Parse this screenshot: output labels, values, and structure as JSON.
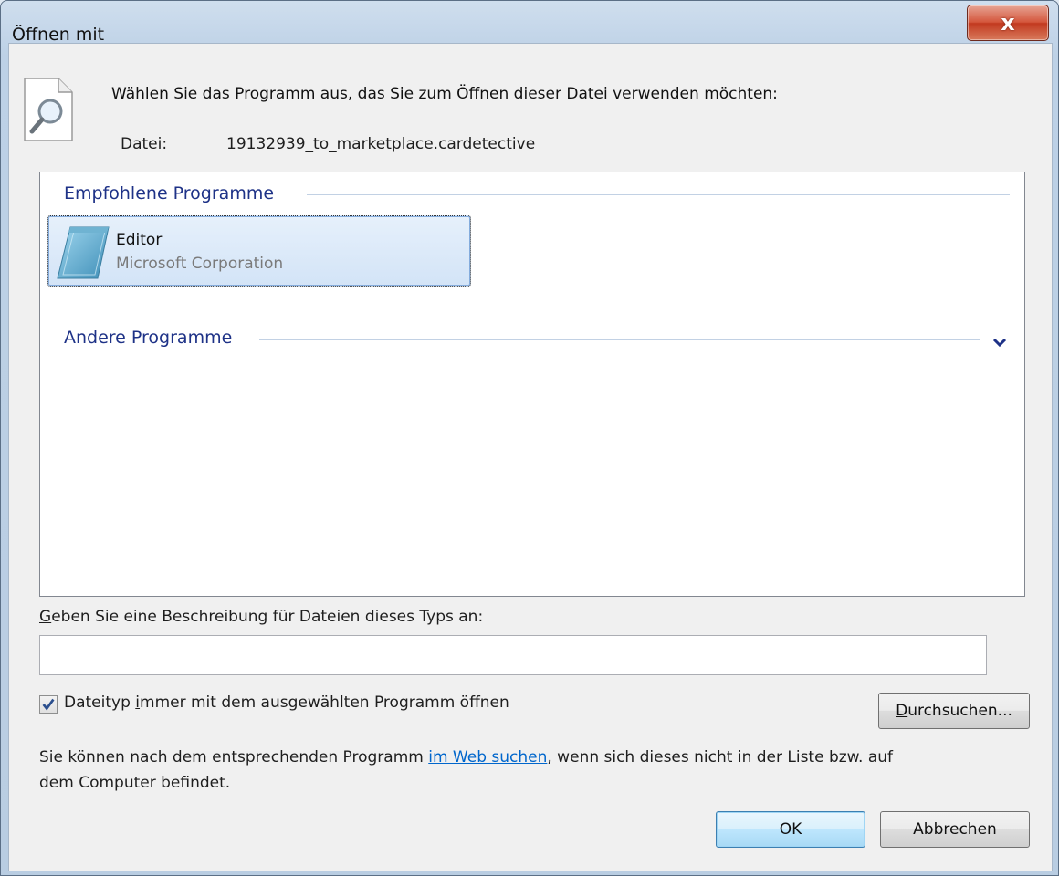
{
  "window": {
    "title": "Öffnen mit",
    "close_glyph": "x"
  },
  "header": {
    "prompt": "Wählen Sie das Programm aus, das Sie zum Öffnen dieser Datei verwenden möchten:",
    "file_label": "Datei:",
    "file_name": "19132939_to_marketplace.cardetective"
  },
  "list": {
    "recommended_header": "Empfohlene Programme",
    "other_header": "Andere Programme",
    "recommended_programs": [
      {
        "name": "Editor",
        "company": "Microsoft Corporation",
        "icon": "notepad-icon"
      }
    ]
  },
  "description": {
    "label_mnemonic": "G",
    "label_rest": "eben Sie eine Beschreibung für Dateien dieses Typs an:",
    "value": "",
    "placeholder": ""
  },
  "always_open": {
    "label_before": "Dateityp ",
    "label_mnemonic": "i",
    "label_after": "mmer mit dem ausgewählten Programm öffnen",
    "checked": true
  },
  "browse_button": {
    "mnemonic": "D",
    "rest": "urchsuchen..."
  },
  "info": {
    "text_before": "Sie können nach dem entsprechenden Programm ",
    "link_text": "im Web suchen",
    "text_after": ", wenn sich dieses nicht in der Liste bzw. auf",
    "line2": "dem Computer befindet."
  },
  "buttons": {
    "ok": "OK",
    "cancel": "Abbrechen"
  },
  "colors": {
    "group_header": "#1e3287",
    "link": "#0066cc",
    "selection": "#d3e4f7",
    "close_button": "#c23a20"
  }
}
